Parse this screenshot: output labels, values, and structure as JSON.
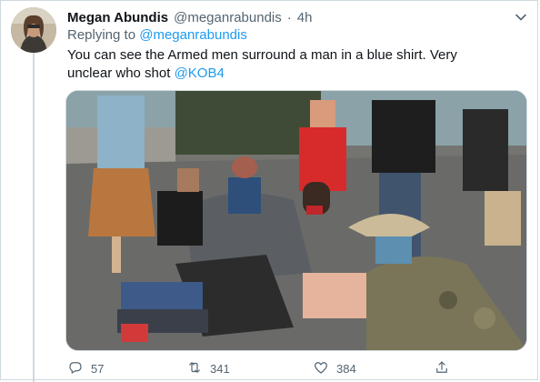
{
  "tweet": {
    "author_name": "Megan Abundis",
    "author_handle": "@meganrabundis",
    "separator": "·",
    "time": "4h",
    "replying_to_prefix": "Replying to ",
    "replying_to_handle": "@meganrabundis",
    "text_main": "You can see the Armed men surround a man in a blue shirt. Very unclear who shot ",
    "text_mention": "@KOB4"
  },
  "actions": {
    "reply_count": "57",
    "retweet_count": "341",
    "like_count": "384"
  },
  "icons": {
    "reply": "reply-icon",
    "retweet": "retweet-icon",
    "like": "heart-icon",
    "share": "share-icon",
    "more": "chevron-down-icon"
  },
  "colors": {
    "link": "#1d9bf0",
    "secondary_text": "#536471",
    "primary_text": "#0f1419",
    "border": "#cfd9de"
  }
}
